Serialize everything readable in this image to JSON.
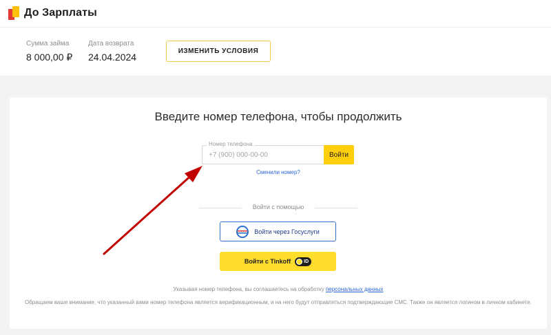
{
  "header": {
    "brand": "До Зарплаты"
  },
  "summary": {
    "loan_amount_label": "Сумма займа",
    "loan_amount_value": "8 000,00 ₽",
    "return_date_label": "Дата возврата",
    "return_date_value": "24.04.2024",
    "change_button": "ИЗМЕНИТЬ УСЛОВИЯ"
  },
  "form": {
    "title": "Введите номер телефона, чтобы продолжить",
    "phone_label": "Номер телефона",
    "phone_placeholder": "+7 (900) 000-00-00",
    "phone_value": "",
    "submit_button": "Войти",
    "changed_number_link": "Сменили номер?"
  },
  "alt_login": {
    "divider_text": "Войти с помощью",
    "gosuslugi_button": "Войти через Госуслуги",
    "tinkoff_button": "Войти с Tinkoff",
    "tinkoff_badge": "ID"
  },
  "legal": {
    "consent_text": "Указывая номер телефона, вы соглашаетесь на обработку ",
    "consent_link": "персональных данных",
    "notice": "Обращаем ваше внимание, что указанный вами номер телефона является верификационным, и на него будут отправляться подтверждающие СМС. Также он является логином в личном кабинете."
  },
  "colors": {
    "accent_yellow": "#ffcf0e",
    "tinkoff_yellow": "#ffdd2d",
    "link_blue": "#2d66d6",
    "annotation_arrow": "#c00000"
  }
}
